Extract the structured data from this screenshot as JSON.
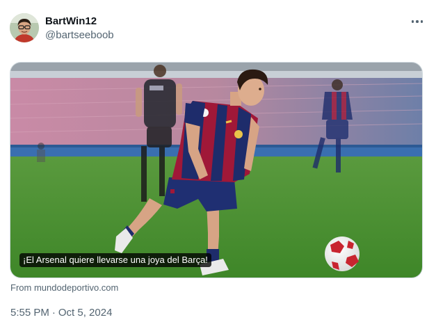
{
  "author": {
    "display_name": "BartWin12",
    "handle": "@bartseeboob"
  },
  "menu": {
    "icon": "more-horizontal-icon"
  },
  "card": {
    "caption": "¡El Arsenal quiere llevarse una joya del Barça!",
    "source_prefix": "From",
    "source_domain": "mundodeportivo.com"
  },
  "meta": {
    "time": "5:55 PM",
    "separator": "·",
    "date": "Oct 5, 2024"
  },
  "colors": {
    "text_primary": "#0f1419",
    "text_secondary": "#536471",
    "border": "#cfd9de",
    "pitch": "#3f8d2d",
    "barca_blue": "#1e2c6b",
    "barca_garnet": "#a01838"
  }
}
